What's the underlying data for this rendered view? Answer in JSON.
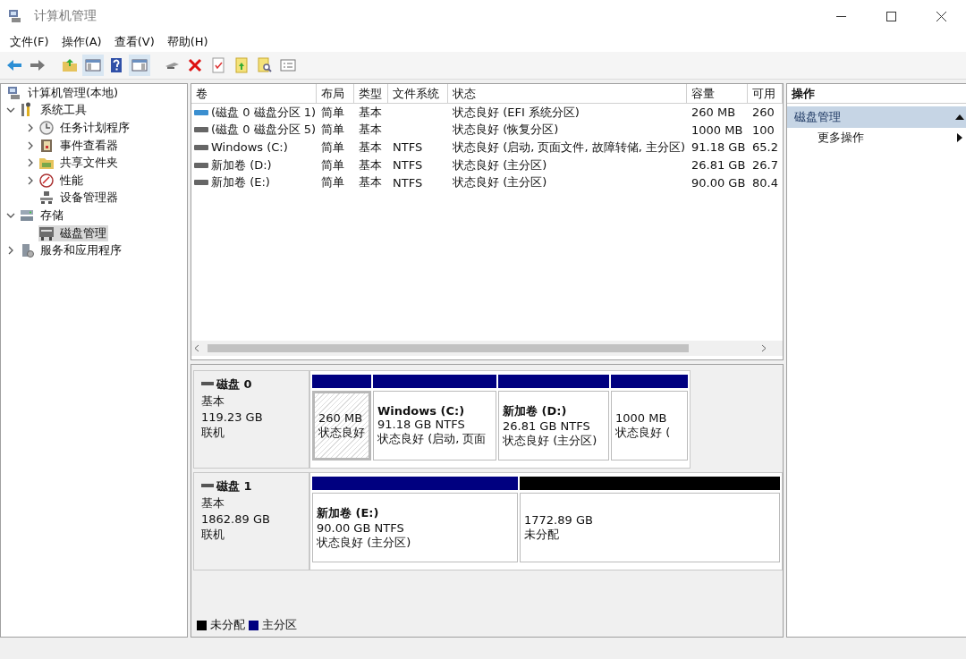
{
  "window": {
    "title": "计算机管理"
  },
  "menu": [
    "文件(F)",
    "操作(A)",
    "查看(V)",
    "帮助(H)"
  ],
  "tree": [
    {
      "label": "计算机管理(本地)",
      "selected": false,
      "children": [
        {
          "label": "系统工具",
          "expanded": true,
          "selected": false,
          "children": [
            {
              "label": "任务计划程序",
              "expanded": false,
              "selected": false
            },
            {
              "label": "事件查看器",
              "expanded": false,
              "selected": false
            },
            {
              "label": "共享文件夹",
              "expanded": false,
              "selected": false
            },
            {
              "label": "性能",
              "expanded": false,
              "selected": false
            },
            {
              "label": "设备管理器",
              "selected": false
            }
          ]
        },
        {
          "label": "存储",
          "expanded": true,
          "selected": false,
          "children": [
            {
              "label": "磁盘管理",
              "selected": true
            }
          ]
        },
        {
          "label": "服务和应用程序",
          "expanded": false,
          "selected": false
        }
      ]
    }
  ],
  "volumes": {
    "columns": [
      "卷",
      "布局",
      "类型",
      "文件系统",
      "状态",
      "容量",
      "可用"
    ],
    "rows": [
      {
        "kind": "efi",
        "cells": [
          "(磁盘 0 磁盘分区 1)",
          "简单",
          "基本",
          "",
          "状态良好 (EFI 系统分区)",
          "260 MB",
          "260"
        ]
      },
      {
        "kind": "volume",
        "cells": [
          "(磁盘 0 磁盘分区 5)",
          "简单",
          "基本",
          "",
          "状态良好 (恢复分区)",
          "1000 MB",
          "100"
        ]
      },
      {
        "kind": "volume",
        "cells": [
          "Windows (C:)",
          "简单",
          "基本",
          "NTFS",
          "状态良好 (启动, 页面文件, 故障转储, 主分区)",
          "91.18 GB",
          "65.2"
        ]
      },
      {
        "kind": "volume",
        "cells": [
          "新加卷 (D:)",
          "简单",
          "基本",
          "NTFS",
          "状态良好 (主分区)",
          "26.81 GB",
          "26.7"
        ]
      },
      {
        "kind": "volume",
        "cells": [
          "新加卷 (E:)",
          "简单",
          "基本",
          "NTFS",
          "状态良好 (主分区)",
          "90.00 GB",
          "80.4"
        ]
      }
    ]
  },
  "disks": [
    {
      "name": "磁盘 0",
      "type": "基本",
      "size": "119.23 GB",
      "status": "联机",
      "partitions": [
        {
          "kind": "primary",
          "selected": true,
          "size": "260 MB",
          "status": "状态良好"
        },
        {
          "kind": "primary",
          "selected": false,
          "name": "Windows  (C:)",
          "size": "91.18 GB NTFS",
          "status": "状态良好 (启动, 页面"
        },
        {
          "kind": "primary",
          "selected": false,
          "name": "新加卷  (D:)",
          "size": "26.81 GB NTFS",
          "status": "状态良好 (主分区)"
        },
        {
          "kind": "primary",
          "selected": false,
          "size": "1000 MB",
          "status": "状态良好 ("
        }
      ]
    },
    {
      "name": "磁盘 1",
      "type": "基本",
      "size": "1862.89 GB",
      "status": "联机",
      "partitions": [
        {
          "kind": "primary",
          "selected": false,
          "name": "新加卷  (E:)",
          "size": "90.00 GB NTFS",
          "status": "状态良好 (主分区)"
        },
        {
          "kind": "unallocated",
          "selected": false,
          "size": "1772.89 GB",
          "status": "未分配"
        }
      ]
    }
  ],
  "legend": [
    {
      "label": "未分配",
      "color": "#000000"
    },
    {
      "label": "主分区",
      "color": "#000080"
    }
  ],
  "actions": {
    "title": "操作",
    "sections": [
      {
        "label": "磁盘管理",
        "expanded": true,
        "items": [
          {
            "label": "更多操作"
          }
        ]
      }
    ]
  }
}
